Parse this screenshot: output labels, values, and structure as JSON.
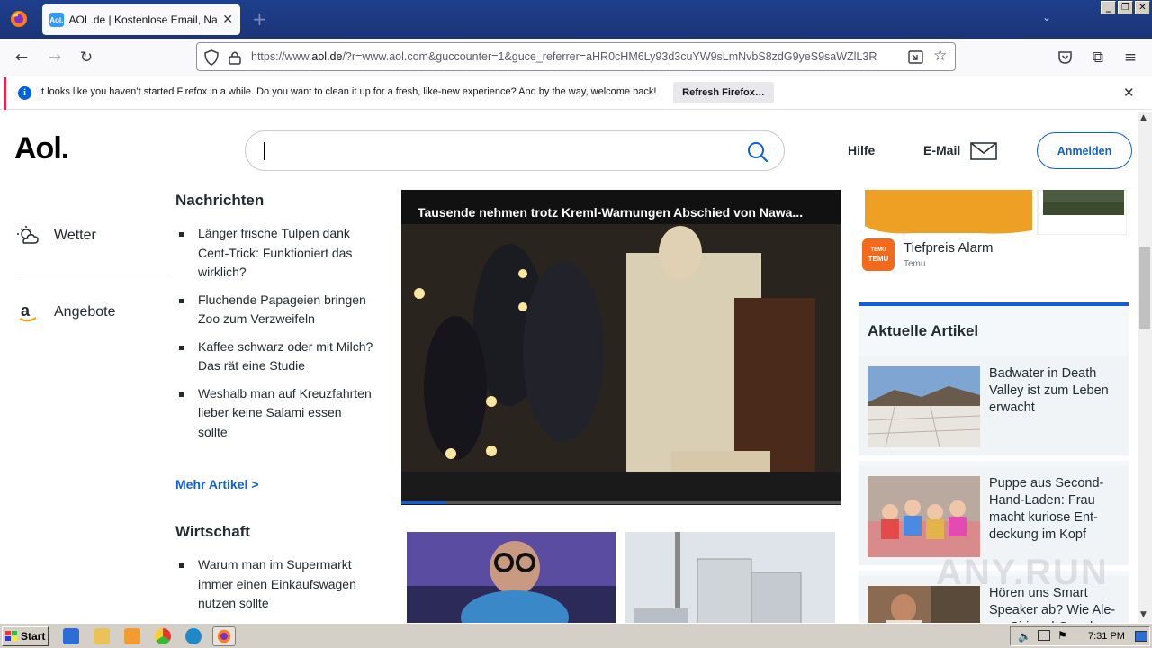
{
  "browser": {
    "tab_title": "AOL.de | Kostenlose Email, Nachric",
    "tab_favicon_text": "Aol.",
    "url_prefix": "https://www.",
    "url_host": "aol.de",
    "url_rest": "/?r=www.aol.com&guccounter=1&guce_referrer=aHR0cHM6Ly93d3cuYW9sLmNvbS8zdG9yeS9saWZlL3R",
    "new_tab_label": "+"
  },
  "notification": {
    "message": "It looks like you haven’t started Firefox in a while. Do you want to clean it up for a fresh, like-new experience? And by the way, welcome back!",
    "button": "Refresh Firefox…"
  },
  "header": {
    "logo": "Aol.",
    "search_value": "",
    "help": "Hilfe",
    "email": "E-Mail",
    "signin": "Anmelden"
  },
  "left_nav": {
    "items": [
      {
        "label": "Wetter",
        "icon": "weather-icon"
      },
      {
        "label": "Angebote",
        "icon": "amazon-icon"
      }
    ]
  },
  "news": {
    "section1_title": "Nachrichten",
    "section1_items": [
      "Länger frische Tulpen dank Cent-Trick: Funktioniert das wirklich?",
      "Fluchende Papageien bringen Zoo zum Verzweifeln",
      "Kaffee schwarz oder mit Milch? Das rät eine Studie",
      "Weshalb man auf Kreuzfahrten lieber keine Salami essen sollte"
    ],
    "more_link": "Mehr Artikel >",
    "section2_title": "Wirtschaft",
    "section2_items": [
      "Warum man im Supermarkt immer einen Einkaufswagen nutzen sollte"
    ]
  },
  "video": {
    "title": "Tausende nehmen trotz Kreml-Warnungen Abschied von Nawa...",
    "progress": 0.1
  },
  "ad": {
    "logo_top": "TEMU",
    "logo_bottom": "TEMU",
    "title": "Tiefpreis Alarm",
    "sponsor": "Temu"
  },
  "articles": {
    "title": "Aktuelle Artikel",
    "items": [
      {
        "text": "Badwater in Death Valley ist zum Leben erwacht"
      },
      {
        "text": "Puppe aus Second-Hand-Laden: Frau macht kuriose Ent-deckung im Kopf"
      },
      {
        "text": "Hören uns Smart Speaker ab? Wie Ale-xa, Siri und Google..."
      }
    ]
  },
  "watermark": "ANY.RUN",
  "taskbar": {
    "start": "Start",
    "clock": "7:31 PM"
  }
}
